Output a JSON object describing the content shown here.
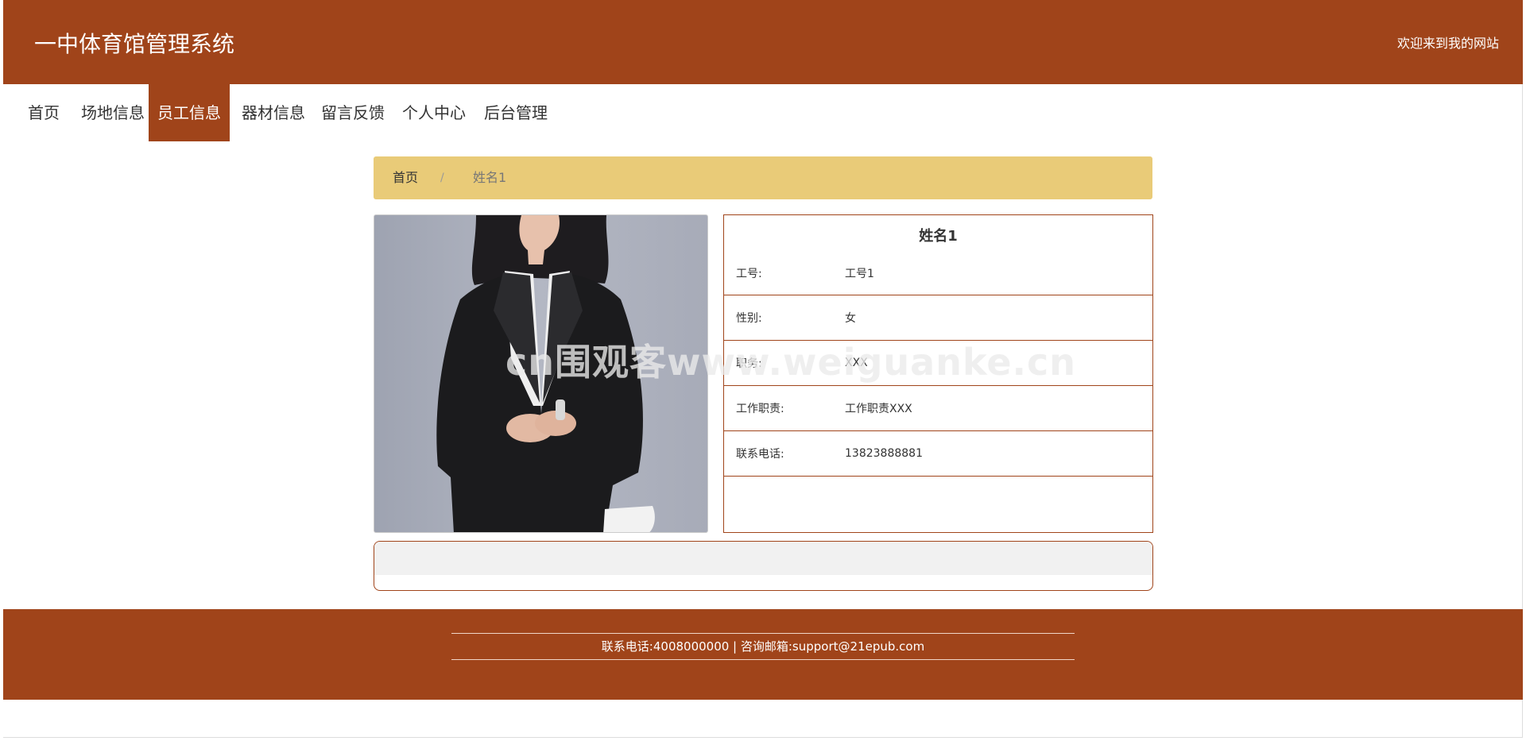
{
  "header": {
    "site_title": "一中体育馆管理系统",
    "welcome": "欢迎来到我的网站"
  },
  "nav": {
    "items": [
      {
        "label": "首页"
      },
      {
        "label": "场地信息"
      },
      {
        "label": "员工信息",
        "active": true
      },
      {
        "label": "器材信息"
      },
      {
        "label": "留言反馈"
      },
      {
        "label": "个人中心"
      },
      {
        "label": "后台管理"
      }
    ]
  },
  "breadcrumb": {
    "home": "首页",
    "separator": "/",
    "current": "姓名1"
  },
  "employee": {
    "name": "姓名1",
    "fields": [
      {
        "label": "工号:",
        "value": "工号1"
      },
      {
        "label": "性别:",
        "value": "女"
      },
      {
        "label": "职务:",
        "value": "XXX"
      },
      {
        "label": "工作职责:",
        "value": "工作职责XXX"
      },
      {
        "label": "联系电话:",
        "value": "13823888881"
      }
    ]
  },
  "footer": {
    "contact": "联系电话:4008000000 | 咨询邮箱:support@21epub.com"
  },
  "watermark": "cn围观客www.weiguanke.cn",
  "colors": {
    "brand": "#a0441a",
    "breadcrumb_bg": "#e9cb78"
  }
}
